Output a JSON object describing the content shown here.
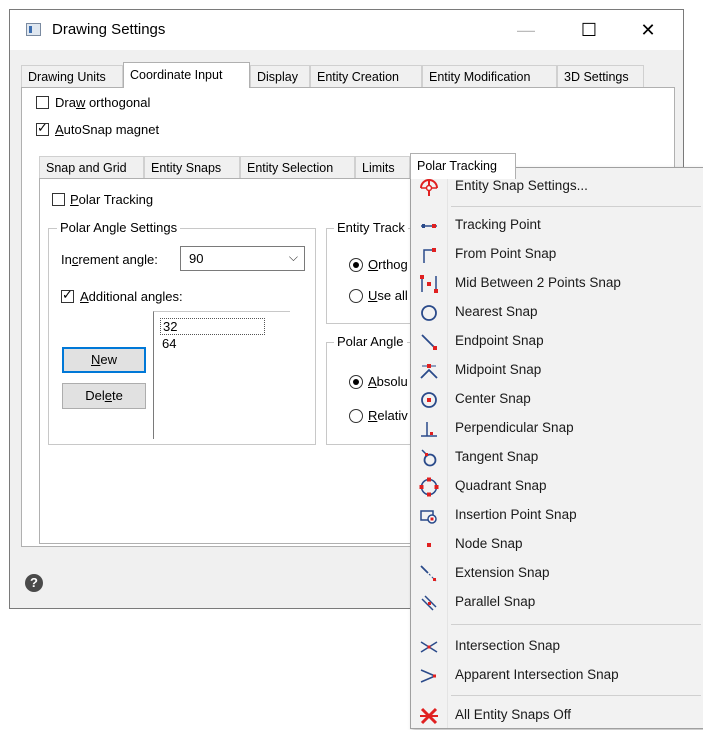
{
  "window": {
    "title": "Drawing Settings"
  },
  "titlebar": {
    "minimize": "—",
    "maximize": "☐",
    "close": "✕"
  },
  "top_tabs": [
    "Drawing Units",
    "Coordinate Input",
    "Display",
    "Entity Creation",
    "Entity Modification",
    "3D Settings"
  ],
  "options": {
    "draw_orthogonal": {
      "pre": "Dra",
      "u": "w",
      "post": " orthogonal",
      "checked": false
    },
    "autosnap_magnet": {
      "pre": "",
      "u": "A",
      "post": "utoSnap magnet",
      "checked": true
    }
  },
  "sub_tabs": [
    "Snap and Grid",
    "Entity Snaps",
    "Entity Selection",
    "Limits",
    "Polar Tracking"
  ],
  "polar": {
    "checkbox": {
      "pre": "",
      "u": "P",
      "post": "olar Tracking",
      "checked": false
    },
    "angle_group_title": "Polar Angle Settings",
    "increment": {
      "pre": "In",
      "u": "c",
      "post": "rement angle:"
    },
    "increment_value": "90",
    "additional": {
      "pre": "",
      "u": "A",
      "post": "dditional angles:",
      "checked": true
    },
    "angles": [
      "32",
      "64"
    ],
    "new_button": {
      "pre": "",
      "u": "N",
      "post": "ew"
    },
    "delete_button": {
      "pre": "Del",
      "u": "e",
      "post": "te"
    },
    "tracking_group_title": "Entity Track",
    "ortho": {
      "pre": "",
      "u": "O",
      "post": "rthog"
    },
    "useall": {
      "pre": "",
      "u": "U",
      "post": "se all"
    },
    "measure_group_title": "Polar Angle",
    "absolute": {
      "pre": "",
      "u": "A",
      "post": "bsolu"
    },
    "relative": {
      "pre": "",
      "u": "R",
      "post": "elativ"
    }
  },
  "help": "?",
  "menu": {
    "items": [
      {
        "label": "Entity Snap Settings...",
        "icon": "entity-snap-settings-icon"
      },
      {
        "label": "Tracking Point",
        "icon": "tracking-point-icon"
      },
      {
        "label": "From Point Snap",
        "icon": "from-point-snap-icon"
      },
      {
        "label": "Mid Between 2 Points Snap",
        "icon": "mid-between-points-icon"
      },
      {
        "label": "Nearest Snap",
        "icon": "nearest-snap-icon"
      },
      {
        "label": "Endpoint Snap",
        "icon": "endpoint-snap-icon"
      },
      {
        "label": "Midpoint Snap",
        "icon": "midpoint-snap-icon"
      },
      {
        "label": "Center Snap",
        "icon": "center-snap-icon"
      },
      {
        "label": "Perpendicular Snap",
        "icon": "perpendicular-snap-icon"
      },
      {
        "label": "Tangent Snap",
        "icon": "tangent-snap-icon"
      },
      {
        "label": "Quadrant Snap",
        "icon": "quadrant-snap-icon"
      },
      {
        "label": "Insertion Point Snap",
        "icon": "insertion-point-snap-icon"
      },
      {
        "label": "Node Snap",
        "icon": "node-snap-icon"
      },
      {
        "label": "Extension Snap",
        "icon": "extension-snap-icon"
      },
      {
        "label": "Parallel Snap",
        "icon": "parallel-snap-icon"
      },
      {
        "label": "Intersection Snap",
        "icon": "intersection-snap-icon"
      },
      {
        "label": "Apparent Intersection Snap",
        "icon": "apparent-intersection-snap-icon"
      },
      {
        "label": "All Entity Snaps Off",
        "icon": "all-snaps-off-icon"
      }
    ]
  },
  "colors": {
    "snap_red": "#e02020",
    "icon_blue": "#2a4a8a",
    "accent": "#0078d7"
  }
}
